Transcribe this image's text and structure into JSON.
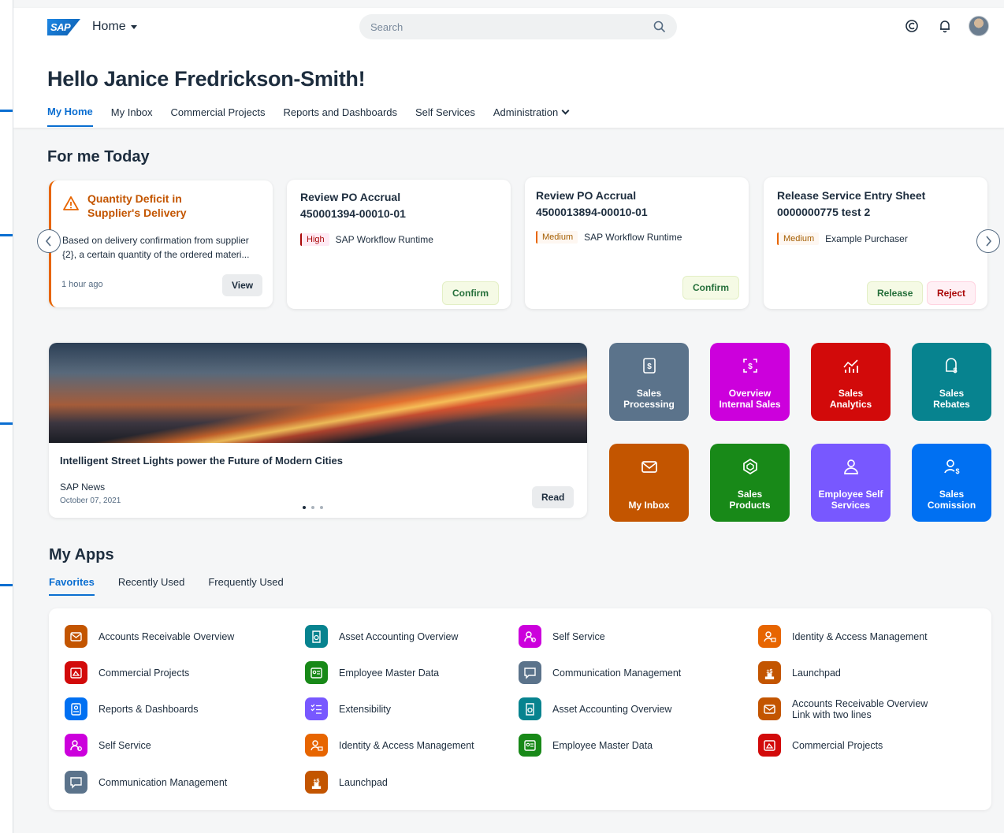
{
  "shell": {
    "logo_text": "SAP",
    "home_label": "Home",
    "search_placeholder": "Search"
  },
  "greeting": "Hello Janice Fredrickson-Smith!",
  "tabs": [
    "My Home",
    "My Inbox",
    "Commercial Projects",
    "Reports and Dashboards",
    "Self Services",
    "Administration"
  ],
  "for_me_today": {
    "title": "For me Today",
    "cards": [
      {
        "title": "Quantity Deficit in Supplier's Delivery",
        "body": "Based on delivery confirmation from supplier {2}, a certain quantity of the ordered materi...",
        "time": "1 hour ago",
        "action": "View"
      },
      {
        "title_line1": "Review PO Accrual",
        "title_line2": "450001394-00010-01",
        "priority": "High",
        "source": "SAP Workflow Runtime",
        "action": "Confirm"
      },
      {
        "title_line1": "Review PO Accrual",
        "title_line2": "4500013894-00010-01",
        "priority": "Medium",
        "source": "SAP Workflow Runtime",
        "action": "Confirm"
      },
      {
        "title_line1": "Release Service Entry Sheet",
        "title_line2": "0000000775 test 2",
        "priority": "Medium",
        "source": "Example Purchaser",
        "action_primary": "Release",
        "action_secondary": "Reject"
      }
    ]
  },
  "news": {
    "title": "Intelligent Street Lights power the Future of Modern Cities",
    "source": "SAP News",
    "date": "October 07, 2021",
    "action": "Read"
  },
  "tiles": [
    {
      "label": "Sales\nProcessing",
      "color": "#5b738b",
      "icon": "dollar-doc-icon"
    },
    {
      "label": "Overview\nInternal Sales",
      "color": "#cc00dc",
      "icon": "dollar-frame-icon"
    },
    {
      "label": "Sales\nAnalytics",
      "color": "#d20a0a",
      "icon": "analytics-icon"
    },
    {
      "label": "Sales\nRebates",
      "color": "#07838f",
      "icon": "rebate-icon"
    },
    {
      "label": "My Inbox",
      "color": "#c35500",
      "icon": "envelope-icon"
    },
    {
      "label": "Sales\nProducts",
      "color": "#188918",
      "icon": "product-icon"
    },
    {
      "label": "Employee Self\nServices",
      "color": "#7858ff",
      "icon": "employee-icon"
    },
    {
      "label": "Sales\nComission",
      "color": "#0070f2",
      "icon": "commission-icon"
    }
  ],
  "my_apps": {
    "title": "My Apps",
    "tabs": [
      "Favorites",
      "Recently Used",
      "Frequently Used"
    ],
    "apps": [
      {
        "label": "Accounts Receivable Overview",
        "color": "#c35500",
        "icon": "envelope-icon"
      },
      {
        "label": "Commercial Projects",
        "color": "#d20a0a",
        "icon": "projects-icon"
      },
      {
        "label": "Reports & Dashboards",
        "color": "#0070f2",
        "icon": "reports-icon"
      },
      {
        "label": "Self Service",
        "color": "#cc00dc",
        "icon": "self-service-icon"
      },
      {
        "label": "Communication Management",
        "color": "#5b738b",
        "icon": "chat-icon"
      },
      {
        "label": "Asset Accounting Overview",
        "color": "#07838f",
        "icon": "asset-icon"
      },
      {
        "label": "Employee Master Data",
        "color": "#188918",
        "icon": "id-card-icon"
      },
      {
        "label": "Extensibility",
        "color": "#7858ff",
        "icon": "checklist-icon"
      },
      {
        "label": "Identity & Access Management",
        "color": "#e76500",
        "icon": "identity-icon"
      },
      {
        "label": "Launchpad",
        "color": "#c35500",
        "icon": "launchpad-icon"
      },
      {
        "label": "Self Service",
        "color": "#cc00dc",
        "icon": "self-service-icon"
      },
      {
        "label": "Communication Management",
        "color": "#5b738b",
        "icon": "chat-icon"
      },
      {
        "label": "Asset Accounting Overview",
        "color": "#07838f",
        "icon": "asset-icon"
      },
      {
        "label": "Employee Master Data",
        "color": "#188918",
        "icon": "id-card-icon"
      },
      {
        "label": "Identity & Access Management",
        "color": "#e76500",
        "icon": "identity-icon"
      },
      {
        "label": "Launchpad",
        "color": "#c35500",
        "icon": "launchpad-icon"
      },
      {
        "label": "Accounts Receivable Overview\nLink with two lines",
        "color": "#c35500",
        "icon": "envelope-icon"
      },
      {
        "label": "Commercial Projects",
        "color": "#d20a0a",
        "icon": "projects-icon"
      }
    ]
  },
  "colors": {
    "accent": "#0a6ed1",
    "warning": "#e76500"
  }
}
